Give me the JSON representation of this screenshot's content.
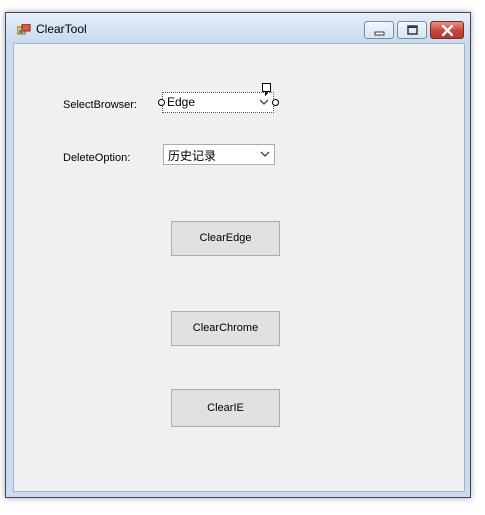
{
  "window": {
    "title": "ClearTool",
    "controls": {
      "minimize": "minimize-icon",
      "maximize": "maximize-icon",
      "close": "close-icon"
    }
  },
  "form": {
    "select_browser_label": "SelectBrowser:",
    "browser_value": "Edge",
    "delete_option_label": "DeleteOption:",
    "delete_option_value": "历史记录"
  },
  "buttons": {
    "clear_edge": "ClearEdge",
    "clear_chrome": "ClearChrome",
    "clear_ie": "ClearIE"
  },
  "colors": {
    "client_bg": "#f0f0f0",
    "button_bg": "#e1e1e1",
    "close_red": "#c7443a"
  }
}
